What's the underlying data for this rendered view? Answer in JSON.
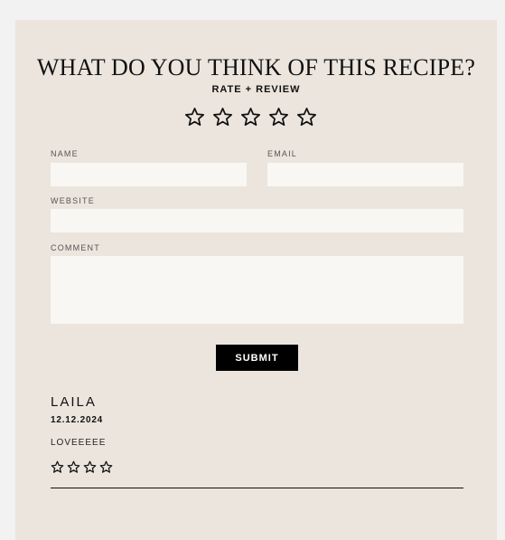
{
  "form": {
    "title": "WHAT DO YOU THINK OF THIS RECIPE?",
    "subtitle": "RATE + REVIEW",
    "rating_icons": [
      "star-outline-icon",
      "star-outline-icon",
      "star-outline-icon",
      "star-outline-icon",
      "star-outline-icon"
    ],
    "name_label": "NAME",
    "name_value": "",
    "email_label": "EMAIL",
    "email_value": "",
    "website_label": "WEBSITE",
    "website_value": "",
    "comment_label": "COMMENT",
    "comment_value": "",
    "submit_label": "SUBMIT"
  },
  "reviews": [
    {
      "name": "LAILA",
      "date": "12.12.2024",
      "text": "LOVEEEEE",
      "star_icons": [
        "star-outline-icon",
        "star-outline-icon",
        "star-outline-icon",
        "star-outline-icon"
      ]
    }
  ],
  "colors": {
    "page_background": "#f3f2f2",
    "card_background": "#ebe5dd",
    "field_background": "#f9f7f3",
    "button_background": "#000000",
    "text": "#111111"
  }
}
